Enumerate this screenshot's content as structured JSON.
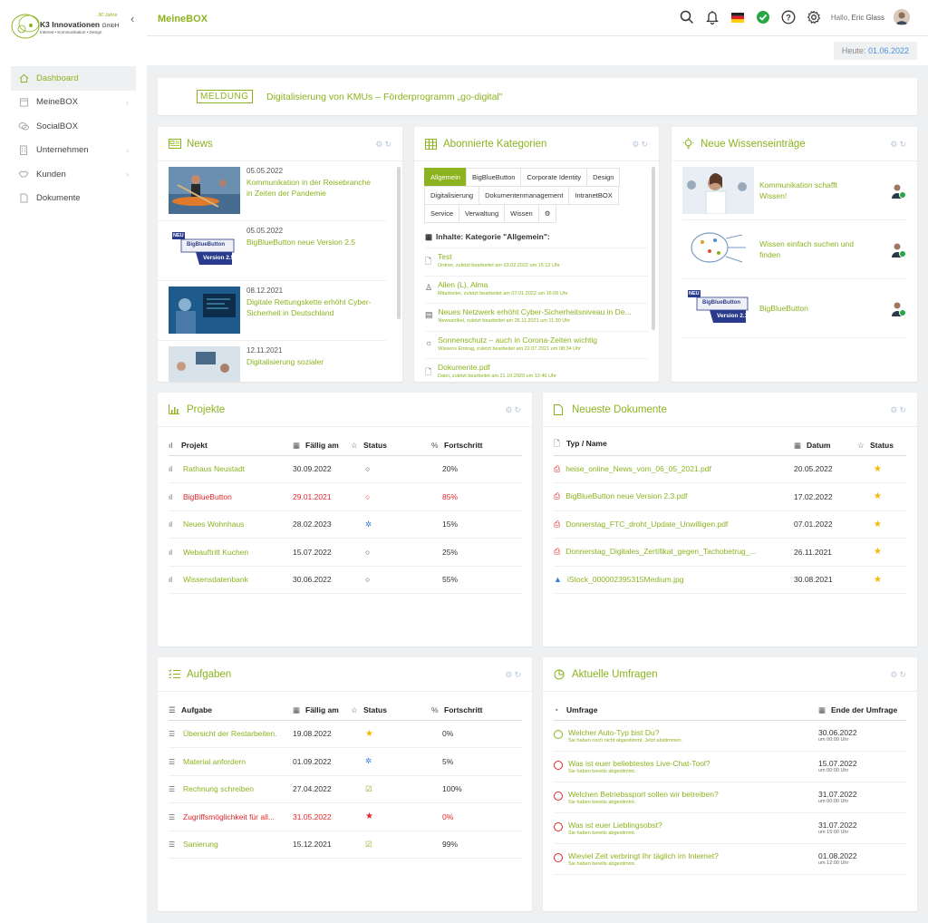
{
  "brand": {
    "name": "K3 Innovationen",
    "suffix": "GmbH",
    "tagline": "Internet • Kommunikation • Design",
    "badge": "30 Jahre",
    "accent": "#8cb31f"
  },
  "sidebar": {
    "items": [
      {
        "label": "Dashboard",
        "icon": "home-icon",
        "active": true
      },
      {
        "label": "MeineBOX",
        "icon": "calendar-icon",
        "chevron": true
      },
      {
        "label": "SocialBOX",
        "icon": "chat-icon"
      },
      {
        "label": "Unternehmen",
        "icon": "building-icon",
        "chevron": true
      },
      {
        "label": "Kunden",
        "icon": "handshake-icon",
        "chevron": true
      },
      {
        "label": "Dokumente",
        "icon": "document-icon"
      }
    ]
  },
  "topbar": {
    "title": "MeineBOX",
    "hello": "Hallo,",
    "user": "Eric Glass"
  },
  "today": {
    "label": "Heute:",
    "date": "01.06.2022"
  },
  "meldung": {
    "tag": "MELDUNG",
    "text": "Digitalisierung von KMUs – Förderprogramm „go-digital\""
  },
  "news": {
    "title": "News",
    "items": [
      {
        "date": "05.05.2022",
        "title": "Kommunikation in der Reisebranche in Zeiten der Pandemie"
      },
      {
        "date": "05.05.2022",
        "title": "BigBlueButton neue Version 2.5"
      },
      {
        "date": "08.12.2021",
        "title": "Digitale Rettungskette erhöht Cyber-Sicherheit in Deutschland"
      },
      {
        "date": "12.11.2021",
        "title": "Digitalisierung sozialer"
      }
    ],
    "img_labels": {
      "neu": "NEU",
      "bbb": "BigBlueButton",
      "version": "Version 2.5"
    }
  },
  "kategorien": {
    "title": "Abonnierte Kategorien",
    "tabs": [
      "Allgemein",
      "BigBlueButton",
      "Corporate Identity",
      "Design",
      "Digitalisierung",
      "Dokumentenmanagement",
      "IntranetBOX",
      "Service",
      "Verwaltung",
      "Wissen"
    ],
    "subtitle": "Inhalte: Kategorie \"Allgemein\":",
    "items": [
      {
        "title": "Test",
        "sub": "Ordner, zuletzt bearbeitet am 03.02.2022 um 15:12 Uhr",
        "icon": "folder-icon"
      },
      {
        "title": "Allen (L), Alma",
        "sub": "Mitarbeiter, zuletzt bearbeitet am 07.01.2022 um 16:06 Uhr",
        "icon": "user-icon"
      },
      {
        "title": "Neues Netzwerk erhöht Cyber-Sicherheitsniveau in De...",
        "sub": "Newsartikel, zuletzt bearbeitet am 26.11.2021 um 11:30 Uhr",
        "icon": "newspaper-icon"
      },
      {
        "title": "Sonnenschutz – auch in Corona-Zeiten wichtig",
        "sub": "Wissens Eintrag, zuletzt bearbeitet am 22.07.2021 um 08:34 Uhr",
        "icon": "lightbulb-icon"
      },
      {
        "title": "Dokumente.pdf",
        "sub": "Datei, zuletzt bearbeitet am 21.10.2020 um 12:46 Uhr",
        "icon": "file-icon"
      }
    ]
  },
  "wissen": {
    "title": "Neue Wissenseinträge",
    "items": [
      {
        "title": "Kommunikation schafft Wissen!"
      },
      {
        "title": "Wissen einfach suchen und finden"
      },
      {
        "title": "BigBlueButton"
      }
    ],
    "img_labels": {
      "neu": "NEU",
      "bbb": "BigBlueButton",
      "version": "Version 2.3"
    }
  },
  "projekte": {
    "title": "Projekte",
    "columns": [
      "Projekt",
      "Fällig am",
      "Status",
      "Fortschritt"
    ],
    "rows": [
      {
        "name": "Rathaus Neustadt",
        "due": "30.09.2022",
        "status": "comment",
        "progress": "20%",
        "overdue": false
      },
      {
        "name": "BigBlueButton",
        "due": "29.01.2021",
        "status": "comment",
        "progress": "85%",
        "overdue": true
      },
      {
        "name": "Neues Wohnhaus",
        "due": "28.02.2023",
        "status": "gears",
        "progress": "15%",
        "overdue": false
      },
      {
        "name": "Webauftritt Kuchen",
        "due": "15.07.2022",
        "status": "comment",
        "progress": "25%",
        "overdue": false
      },
      {
        "name": "Wissensdatenbank",
        "due": "30.06.2022",
        "status": "comment",
        "progress": "55%",
        "overdue": false
      }
    ]
  },
  "dokumente": {
    "title": "Neueste Dokumente",
    "columns": [
      "Typ / Name",
      "Datum",
      "Status"
    ],
    "rows": [
      {
        "name": "heise_online_News_vom_06_05_2021.pdf",
        "date": "20.05.2022",
        "type": "pdf"
      },
      {
        "name": "BigBlueButton neue Version 2.3.pdf",
        "date": "17.02.2022",
        "type": "pdf"
      },
      {
        "name": "Donnerstag_FTC_droht_Update_Unwilligen.pdf",
        "date": "07.01.2022",
        "type": "pdf"
      },
      {
        "name": "Donnerstag_Digitales_Zertifikat_gegen_Tachobetrug_...",
        "date": "26.11.2021",
        "type": "pdf"
      },
      {
        "name": "iStock_000002395315Medium.jpg",
        "date": "30.08.2021",
        "type": "image"
      }
    ]
  },
  "aufgaben": {
    "title": "Aufgaben",
    "columns": [
      "Aufgabe",
      "Fällig am",
      "Status",
      "Fortschritt"
    ],
    "rows": [
      {
        "name": "Übersicht der Restarbeiten.",
        "due": "19.08.2022",
        "status": "star",
        "progress": "0%",
        "overdue": false
      },
      {
        "name": "Material anfordern",
        "due": "01.09.2022",
        "status": "gears",
        "progress": "5%",
        "overdue": false
      },
      {
        "name": "Rechnung schreiben",
        "due": "27.04.2022",
        "status": "check",
        "progress": "100%",
        "overdue": false
      },
      {
        "name": "Zugriffsmöglichkeit für all...",
        "due": "31.05.2022",
        "status": "star-red",
        "progress": "0%",
        "overdue": true
      },
      {
        "name": "Sanierung",
        "due": "15.12.2021",
        "status": "check",
        "progress": "99%",
        "overdue": false
      }
    ]
  },
  "umfragen": {
    "title": "Aktuelle Umfragen",
    "columns": [
      "Umfrage",
      "Ende der Umfrage"
    ],
    "rows": [
      {
        "title": "Welcher Auto-Typ bist Du?",
        "sub": "Sie haben noch nicht abgestimmt. Jetzt abstimmen.",
        "date": "30.06.2022",
        "time": "um 00:00 Uhr",
        "voted": false
      },
      {
        "title": "Was ist euer beliebtestes Live-Chat-Tool?",
        "sub": "Sie haben bereits abgestimmt.",
        "date": "15.07.2022",
        "time": "um 00:00 Uhr",
        "voted": true
      },
      {
        "title": "Welchen Betriebssport sollen wir betreiben?",
        "sub": "Sie haben bereits abgestimmt.",
        "date": "31.07.2022",
        "time": "um 00:00 Uhr",
        "voted": true
      },
      {
        "title": "Was ist euer Lieblingsobst?",
        "sub": "Sie haben bereits abgestimmt.",
        "date": "31.07.2022",
        "time": "um 15:00 Uhr",
        "voted": true
      },
      {
        "title": "Wieviel Zeit verbringt Ihr täglich im Internet?",
        "sub": "Sie haben bereits abgestimmt.",
        "date": "01.08.2022",
        "time": "um 12:00 Uhr",
        "voted": true
      }
    ]
  }
}
